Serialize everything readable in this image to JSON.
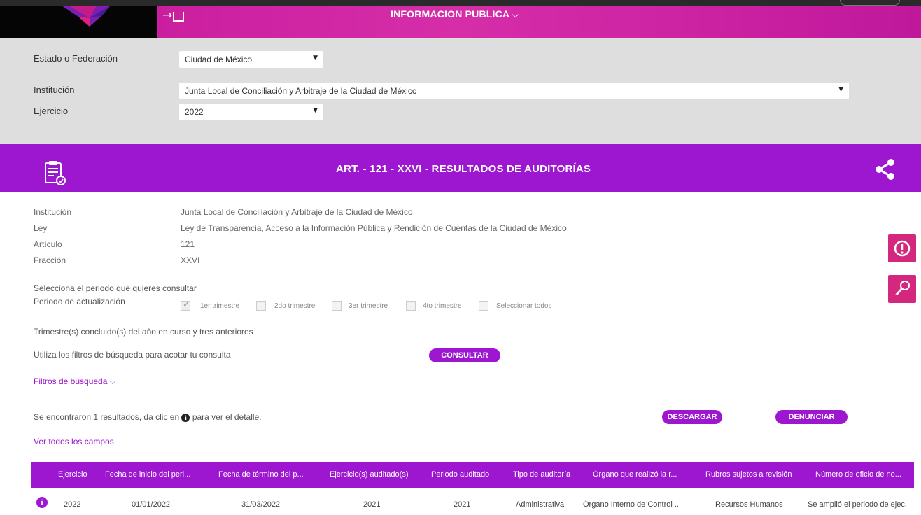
{
  "header": {
    "nav_title": "INFORMACION PUBLICA",
    "colors": {
      "header": "#c4169a",
      "accent": "#9d16d0",
      "side_buttons": "#d4277e",
      "filter_bg": "#dedede"
    },
    "icons": [
      "logo",
      "login-icon",
      "chevron-down-icon"
    ]
  },
  "filters": {
    "estado_label": "Estado o Federación",
    "estado_value": "Ciudad de México",
    "institucion_label": "Institución",
    "institucion_value": "Junta Local de Conciliación y Arbitraje de la Ciudad de México",
    "ejercicio_label": "Ejercicio",
    "ejercicio_value": "2022"
  },
  "band": {
    "title": "ART. - 121 - XXVI - RESULTADOS DE AUDITORÍAS",
    "icons": [
      "clipboard-icon",
      "share-icon"
    ]
  },
  "info": {
    "institucion_label": "Institución",
    "institucion_value": "Junta Local de Conciliación y Arbitraje de la Ciudad de México",
    "ley_label": "Ley",
    "ley_value": "Ley de Transparencia, Acceso a la Información Pública y Rendición de Cuentas de la Ciudad de México",
    "articulo_label": "Artículo",
    "articulo_value": "121",
    "fraccion_label": "Fracción",
    "fraccion_value": "XXVI"
  },
  "periodo": {
    "select_text": "Selecciona el periodo que quieres consultar",
    "label": "Periodo de actualización",
    "options": [
      {
        "label": "1er trimestre",
        "checked": true
      },
      {
        "label": "2do trimestre",
        "checked": false
      },
      {
        "label": "3er trimestre",
        "checked": false
      },
      {
        "label": "4to trimestre",
        "checked": false
      },
      {
        "label": "Seleccionar todos",
        "checked": false
      }
    ],
    "note": "Trimestre(s) concluido(s) del año en curso y tres anteriores"
  },
  "search": {
    "hint": "Utiliza los filtros de búsqueda para acotar tu consulta",
    "consultar": "CONSULTAR",
    "filtros_link": "Filtros de búsqueda"
  },
  "results": {
    "text_before": "Se encontraron 1 resultados, da clic en",
    "text_after": "para ver el detalle.",
    "descargar": "DESCARGAR",
    "denunciar": "DENUNCIAR",
    "ver_todos": "Ver todos los campos"
  },
  "table": {
    "headers": [
      "Ejercicio",
      "Fecha de inicio del peri...",
      "Fecha de término del p...",
      "Ejercicio(s) auditado(s)",
      "Periodo auditado",
      "Tipo de auditoría",
      "Órgano que realizó la r...",
      "Rubros sujetos a revisión",
      "Número de oficio de no..."
    ],
    "rows": [
      [
        "2022",
        "01/01/2022",
        "31/03/2022",
        "2021",
        "2021",
        "Administrativa",
        "Órgano Interno de Control ...",
        "Recursos Humanos",
        "Se amplió el periodo de ejec."
      ]
    ]
  }
}
